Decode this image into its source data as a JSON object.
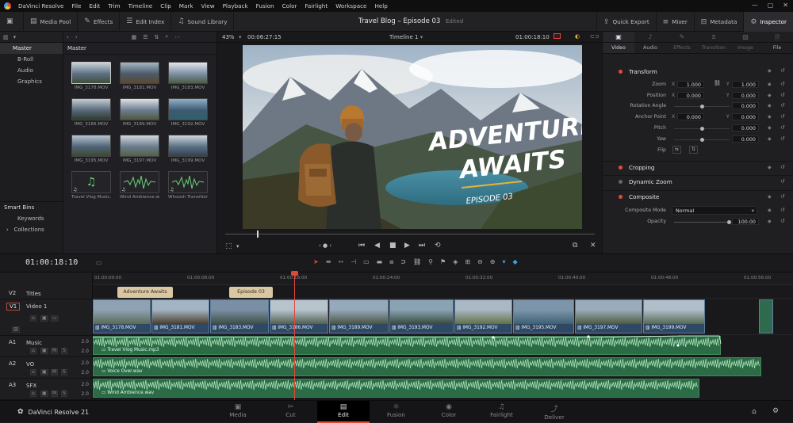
{
  "menu": {
    "app_name": "DaVinci Resolve",
    "items": [
      "File",
      "Edit",
      "Trim",
      "Timeline",
      "Clip",
      "Mark",
      "View",
      "Playback",
      "Fusion",
      "Color",
      "Fairlight",
      "Workspace",
      "Help"
    ]
  },
  "toolbar": {
    "media_pool": "Media Pool",
    "effects": "Effects",
    "edit_index": "Edit Index",
    "sound_library": "Sound Library",
    "project_title": "Travel Blog – Episode 03",
    "status": "Edited",
    "quick_export": "Quick Export",
    "mixer": "Mixer",
    "metadata": "Metadata",
    "inspector": "Inspector"
  },
  "bins": {
    "master": "Master",
    "items": [
      "B-Roll",
      "Audio",
      "Graphics"
    ],
    "smart_bins": "Smart Bins",
    "smart_items": [
      "Keywords",
      "Collections"
    ]
  },
  "pool": {
    "header": "Master",
    "clips": [
      {
        "name": "IMG_3178.MOV",
        "type": "video"
      },
      {
        "name": "IMG_3181.MOV",
        "type": "video"
      },
      {
        "name": "IMG_3183.MOV",
        "type": "video"
      },
      {
        "name": "IMG_3186.MOV",
        "type": "video"
      },
      {
        "name": "IMG_3189.MOV",
        "type": "video"
      },
      {
        "name": "IMG_3192.MOV",
        "type": "video"
      },
      {
        "name": "IMG_3195.MOV",
        "type": "video"
      },
      {
        "name": "IMG_3197.MOV",
        "type": "video"
      },
      {
        "name": "IMG_3199.MOV",
        "type": "video"
      },
      {
        "name": "Travel Vlog Music.mp",
        "type": "audio"
      },
      {
        "name": "Wind Ambience.wav",
        "type": "audio"
      },
      {
        "name": "Whoosh Transition...",
        "type": "audio"
      }
    ]
  },
  "viewer": {
    "zoom": "43%",
    "duration": "00:06:27:15",
    "timeline_name": "Timeline 1",
    "timecode": "01:00:18:10",
    "overlay_title_line1": "ADVENTURE",
    "overlay_title_line2": "AWAITS",
    "overlay_subtitle": "EPISODE 03"
  },
  "inspector": {
    "tabs": [
      "Video",
      "Audio",
      "Effects",
      "Transition",
      "Image",
      "File"
    ],
    "sections": {
      "transform": "Transform",
      "cropping": "Cropping",
      "dynamic_zoom": "Dynamic Zoom",
      "composite": "Composite"
    },
    "props": {
      "zoom": "Zoom",
      "zoom_x": "1.000",
      "zoom_y": "1.000",
      "position": "Position",
      "pos_x": "0.000",
      "pos_y": "0.000",
      "rotation": "Rotation Angle",
      "rotation_val": "0.000",
      "anchor": "Anchor Point",
      "anchor_x": "0.000",
      "anchor_y": "0.000",
      "pitch": "Pitch",
      "pitch_val": "0.000",
      "yaw": "Yaw",
      "yaw_val": "0.000",
      "flip": "Flip",
      "composite_mode": "Composite Mode",
      "composite_mode_val": "Normal",
      "opacity": "Opacity",
      "opacity_val": "100.00",
      "axis_x": "X",
      "axis_y": "Y"
    }
  },
  "timeline": {
    "timecode": "01:00:18:10",
    "ruler": [
      "01:00:00:00",
      "01:00:08:00",
      "01:00:16:00",
      "01:00:24:00",
      "01:00:32:00",
      "01:00:40:00",
      "01:00:48:00",
      "01:00:56:00"
    ],
    "tracks": [
      {
        "id": "V2",
        "name": "Titles",
        "vol": ""
      },
      {
        "id": "V1",
        "name": "Video 1",
        "vol": ""
      },
      {
        "id": "A1",
        "name": "Music",
        "vol": "2.0"
      },
      {
        "id": "A2",
        "name": "VO",
        "vol": "2.0"
      },
      {
        "id": "A3",
        "name": "SFX",
        "vol": "2.0"
      }
    ],
    "titles": [
      "Adventure Awaits",
      "Episode 03"
    ],
    "video_clips": [
      "IMG_3178.MOV",
      "IMG_3181.MOV",
      "IMG_3183.MOV",
      "IMG_3186.MOV",
      "IMG_3189.MOV",
      "IMG_3193.MOV",
      "IMG_3192.MOV",
      "IMG_3195.MOV",
      "IMG_3197.MOV",
      "IMG_3199.MOV"
    ],
    "audio_clips": [
      "Travel Vlog Music.mp3",
      "Voice Over.wav",
      "Wind Ambience.wav"
    ]
  },
  "pages": {
    "brand": "DaVinci Resolve 21",
    "items": [
      "Media",
      "Cut",
      "Edit",
      "Fusion",
      "Color",
      "Fairlight",
      "Deliver"
    ],
    "active": "Edit"
  },
  "colors": {
    "accent": "#e0483c",
    "video_clip": "#2f4965",
    "audio_clip": "#2b6b45",
    "title_clip": "#d9c7a3"
  }
}
